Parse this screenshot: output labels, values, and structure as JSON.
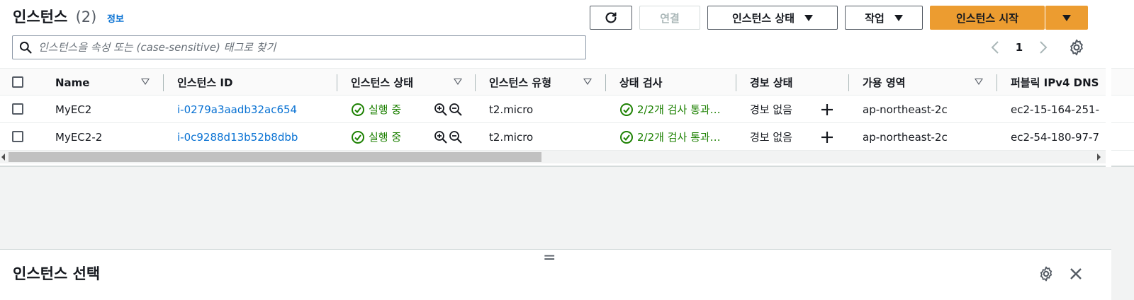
{
  "header": {
    "title": "인스턴스",
    "count": "(2)",
    "info_link": "정보"
  },
  "toolbar": {
    "connect_label": "연결",
    "instance_state_label": "인스턴스 상태",
    "actions_label": "작업",
    "launch_label": "인스턴스 시작"
  },
  "search": {
    "placeholder": "인스턴스을 속성 또는 (case-sensitive) 태그로 찾기"
  },
  "pagination": {
    "current_page": "1"
  },
  "table": {
    "columns": [
      "Name",
      "인스턴스 ID",
      "인스턴스 상태",
      "인스턴스 유형",
      "상태 검사",
      "경보 상태",
      "가용 영역",
      "퍼블릭 IPv4 DNS"
    ],
    "rows": [
      {
        "name": "MyEC2",
        "instance_id": "i-0279a3aadb32ac654",
        "state": "실행 중",
        "type": "t2.micro",
        "status_check": "2/2개 검사 통과…",
        "alarm": "경보 없음",
        "az": "ap-northeast-2c",
        "public_dns": "ec2-15-164-251-"
      },
      {
        "name": "MyEC2-2",
        "instance_id": "i-0c9288d13b52b8dbb",
        "state": "실행 중",
        "type": "t2.micro",
        "status_check": "2/2개 검사 통과…",
        "alarm": "경보 없음",
        "az": "ap-northeast-2c",
        "public_dns": "ec2-54-180-97-7"
      }
    ]
  },
  "bottom_panel": {
    "title": "인스턴스 선택",
    "handle": "="
  },
  "colors": {
    "primary": "#ec9c30",
    "link": "#0972d3",
    "success": "#1d8102"
  }
}
